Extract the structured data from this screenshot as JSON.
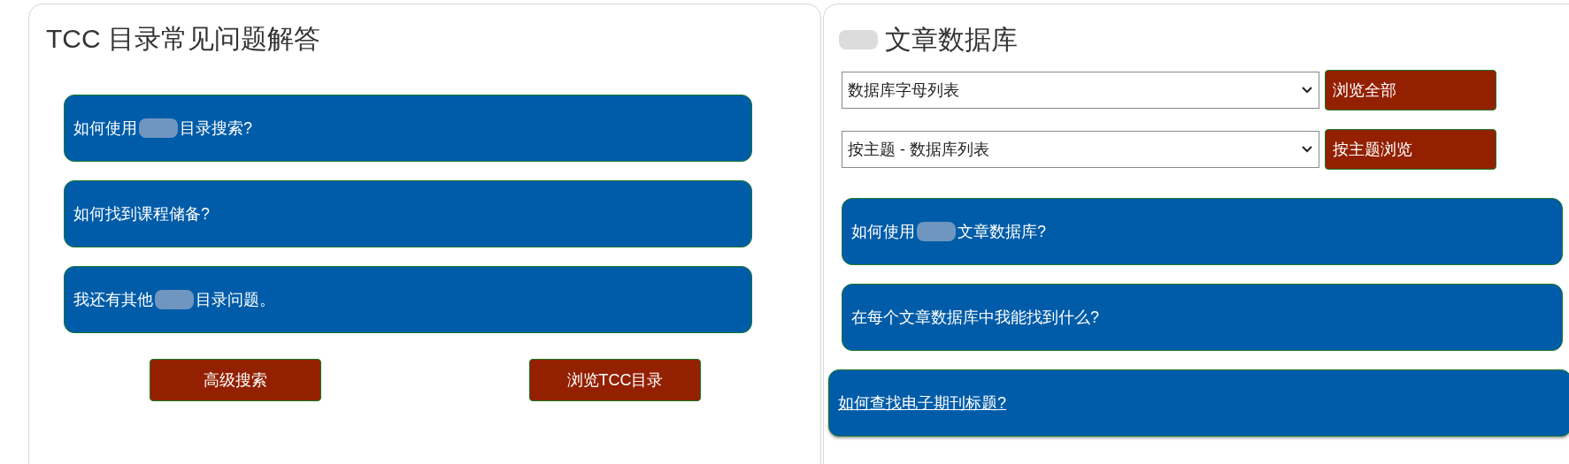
{
  "faq_panel": {
    "title": "TCC 目录常见问题解答",
    "questions": [
      {
        "before": "如何使用",
        "after": "目录搜索?",
        "redacted": true
      },
      {
        "before": "如何找到课程储备?",
        "redacted": false
      },
      {
        "before": "我还有其他",
        "after": "目录问题。",
        "redacted": true
      }
    ],
    "buttons": [
      "高级搜索",
      "浏览TCC目录"
    ]
  },
  "database_panel": {
    "title_after": "文章数据库",
    "title_redacted": true,
    "selects": [
      {
        "value": "数据库字母列表",
        "button": "浏览全部"
      },
      {
        "value": "按主题 - 数据库列表",
        "button": "按主题浏览"
      }
    ],
    "questions": [
      {
        "before": "如何使用",
        "after": "文章数据库?",
        "redacted": true,
        "underlined": false
      },
      {
        "before": "在每个文章数据库中我能找到什么?",
        "redacted": false,
        "underlined": false
      },
      {
        "before": "如何查找电子期刊标题?",
        "redacted": false,
        "underlined": true
      }
    ]
  }
}
